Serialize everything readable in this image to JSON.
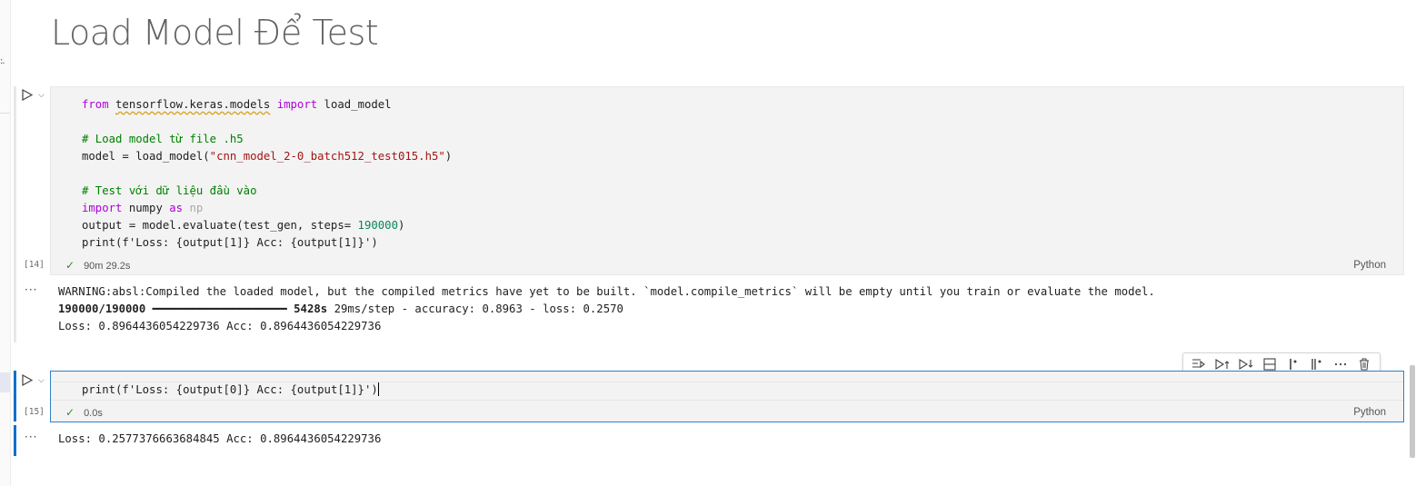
{
  "notebook": {
    "markdown_heading": "Load Model Để Test",
    "cells": [
      {
        "exec_count": "[14]",
        "duration": "90m 29.2s",
        "language": "Python",
        "code": {
          "l1_kw": "from",
          "l1_mod": "tensorflow.keras.models",
          "l1_kw2": "import",
          "l1_name": "load_model",
          "l3": "# Load model từ file .h5",
          "l4_a": "model = load_model(",
          "l4_str": "\"cnn_model_2-0_batch512_test015.h5\"",
          "l4_b": ")",
          "l6": "# Test với dữ liệu đầu vào",
          "l7_kw": "import",
          "l7_mid": "numpy",
          "l7_as": "as",
          "l7_np": "np",
          "l8_a": "output = model.evaluate(test_gen, steps= ",
          "l8_num": "190000",
          "l8_b": ")",
          "l9_fn": "print",
          "l9_a": "(f'Loss: {output[1]} Acc: {output[1]}')"
        },
        "output": {
          "warning": "WARNING:absl:Compiled the loaded model, but the compiled metrics have yet to be built. `model.compile_metrics` will be empty until you train or evaluate the model.",
          "progress_step": "190000/190000",
          "progress_bar": "━━━━━━━━━━━━━━━━━━━━",
          "progress_time": "5428s",
          "progress_rest": " 29ms/step - accuracy: 0.8963 - loss: 0.2570",
          "result": "Loss: 0.8964436054229736 Acc: 0.8964436054229736"
        }
      },
      {
        "exec_count": "[15]",
        "duration": "0.0s",
        "language": "Python",
        "code": {
          "fn": "print",
          "args": "(f'Loss: {output[0]} Acc: {output[1]}')"
        },
        "output": {
          "result": "Loss: 0.2577376663684845 Acc: 0.8964436054229736"
        }
      }
    ],
    "output_ellipsis": "···",
    "toolbar_icons": [
      "run-by-line-icon",
      "execute-above-icon",
      "execute-below-icon",
      "split-cell-icon",
      "run-cells-above-icon",
      "run-cells-below-icon",
      "more-actions-icon",
      "delete-icon"
    ],
    "colors": {
      "active_cell_bar": "#0e71c8",
      "keyword": "#af00db",
      "comment": "#008000",
      "string": "#a31515",
      "number": "#098658",
      "success_check": "#388a34"
    }
  }
}
